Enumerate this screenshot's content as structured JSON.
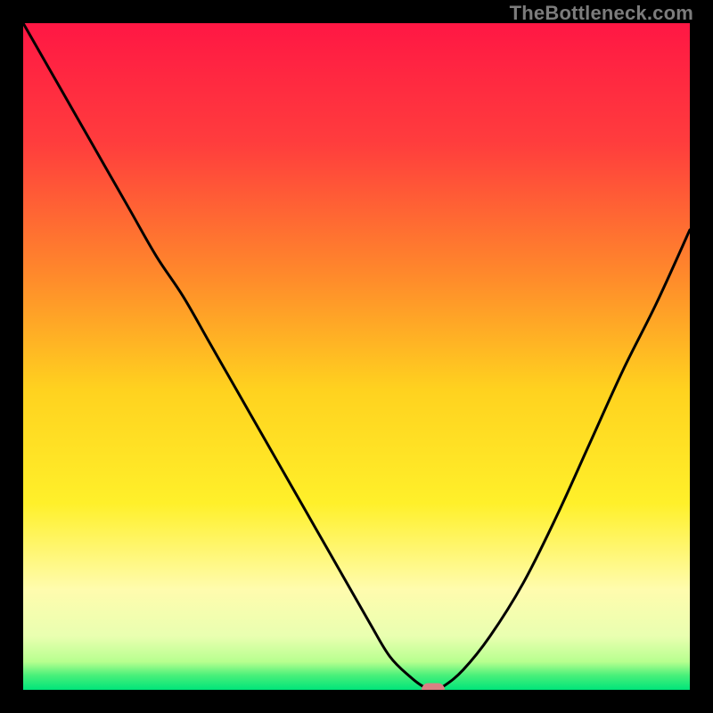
{
  "watermark": "TheBottleneck.com",
  "colors": {
    "frame": "#000000",
    "watermark": "#7c7c7c",
    "curve": "#000000",
    "marker": "#d98083",
    "gradient_stops": [
      {
        "offset": 0.0,
        "color": "#ff1744"
      },
      {
        "offset": 0.18,
        "color": "#ff3d3d"
      },
      {
        "offset": 0.38,
        "color": "#ff8a2b"
      },
      {
        "offset": 0.55,
        "color": "#ffd21f"
      },
      {
        "offset": 0.72,
        "color": "#fff02a"
      },
      {
        "offset": 0.85,
        "color": "#fffcae"
      },
      {
        "offset": 0.92,
        "color": "#e9ffb0"
      },
      {
        "offset": 0.958,
        "color": "#b7ff8f"
      },
      {
        "offset": 0.978,
        "color": "#4af07a"
      },
      {
        "offset": 1.0,
        "color": "#00e57a"
      }
    ]
  },
  "chart_data": {
    "type": "line",
    "title": "",
    "xlabel": "",
    "ylabel": "",
    "xlim": [
      0,
      100
    ],
    "ylim": [
      0,
      100
    ],
    "grid": false,
    "series": [
      {
        "name": "bottleneck-curve",
        "x": [
          0,
          4,
          8,
          12,
          16,
          20,
          24,
          28,
          32,
          36,
          40,
          44,
          48,
          52,
          55,
          58,
          60,
          61.5,
          63,
          66,
          70,
          75,
          80,
          85,
          90,
          95,
          100
        ],
        "values": [
          100,
          93,
          86,
          79,
          72,
          65,
          59,
          52,
          45,
          38,
          31,
          24,
          17,
          10,
          5,
          2,
          0.5,
          0,
          0.5,
          3,
          8,
          16,
          26,
          37,
          48,
          58,
          69
        ]
      }
    ],
    "marker": {
      "x": 61.5,
      "y": 0
    }
  }
}
